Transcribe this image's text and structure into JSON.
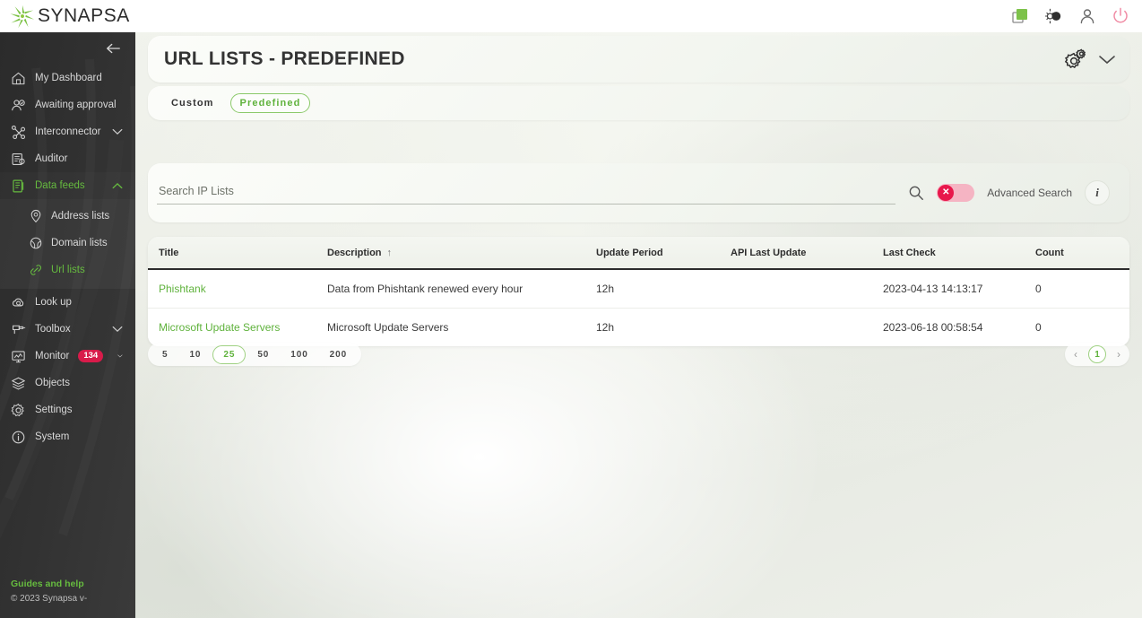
{
  "brand": {
    "name": "SYNAPSA",
    "logo_icon": "synapsa-starburst-logo",
    "accent": "#66bb3f",
    "danger": "#e8174b"
  },
  "topbar": {
    "icons": [
      {
        "name": "copy-icon",
        "color": "#7dc24a"
      },
      {
        "name": "theme-toggle-icon",
        "color": "#3a3a3a"
      },
      {
        "name": "user-icon",
        "color": "#6b6b6b"
      },
      {
        "name": "power-icon",
        "color": "#f08ca5"
      }
    ]
  },
  "sidebar": {
    "collapse_icon": "arrow-left-icon",
    "items": [
      {
        "label": "My Dashboard",
        "icon": "home-icon",
        "chevron": false,
        "active": false
      },
      {
        "label": "Awaiting approval",
        "icon": "user-check-icon",
        "chevron": false,
        "active": false
      },
      {
        "label": "Interconnector",
        "icon": "network-icon",
        "chevron": true,
        "active": false
      },
      {
        "label": "Auditor",
        "icon": "server-audit-icon",
        "chevron": false,
        "active": false
      },
      {
        "label": "Data feeds",
        "icon": "data-feeds-icon",
        "chevron": true,
        "active": true,
        "expanded": true
      }
    ],
    "sub_items": [
      {
        "label": "Address lists",
        "icon": "map-pin-icon",
        "active": false
      },
      {
        "label": "Domain lists",
        "icon": "globe-icon",
        "active": false
      },
      {
        "label": "Url lists",
        "icon": "link-icon",
        "active": true
      }
    ],
    "items_after": [
      {
        "label": "Look up",
        "icon": "cloud-search-icon",
        "chevron": false,
        "badge": null
      },
      {
        "label": "Toolbox",
        "icon": "drill-icon",
        "chevron": true,
        "badge": null
      },
      {
        "label": "Monitor",
        "icon": "monitor-icon",
        "chevron": true,
        "badge": "134"
      },
      {
        "label": "Objects",
        "icon": "layers-icon",
        "chevron": false,
        "badge": null
      },
      {
        "label": "Settings",
        "icon": "gear-icon",
        "chevron": false,
        "badge": null
      },
      {
        "label": "System",
        "icon": "info-circle-icon",
        "chevron": false,
        "badge": null
      }
    ],
    "footer": {
      "guides": "Guides and help",
      "copyright": "© 2023 Synapsa v-"
    }
  },
  "header": {
    "title": "URL LISTS - PREDEFINED",
    "gears_icon": "gears-settings-icon",
    "chevron_icon": "chevron-down-icon"
  },
  "tabs": [
    {
      "label": "Custom",
      "active": false
    },
    {
      "label": "Predefined",
      "active": true
    }
  ],
  "search": {
    "placeholder": "Search IP Lists",
    "value": "",
    "search_icon": "search-icon",
    "advanced_label": "Advanced Search",
    "advanced_enabled": false,
    "toggle_glyph": "✕",
    "info_glyph": "i"
  },
  "table": {
    "columns": [
      {
        "key": "title",
        "label": "Title",
        "sorted": false
      },
      {
        "key": "desc",
        "label": "Description",
        "sorted": true,
        "sort_glyph": "↑"
      },
      {
        "key": "period",
        "label": "Update Period",
        "sorted": false
      },
      {
        "key": "api",
        "label": "API Last Update",
        "sorted": false
      },
      {
        "key": "check",
        "label": "Last Check",
        "sorted": false
      },
      {
        "key": "count",
        "label": "Count",
        "sorted": false
      }
    ],
    "rows": [
      {
        "title": "Phishtank",
        "desc": "Data from Phishtank renewed every hour",
        "period": "12h",
        "api": "",
        "check": "2023-04-13 14:13:17",
        "count": "0"
      },
      {
        "title": "Microsoft Update Servers",
        "desc": "Microsoft Update Servers",
        "period": "12h",
        "api": "",
        "check": "2023-06-18 00:58:54",
        "count": "0"
      }
    ]
  },
  "pagination": {
    "page_sizes": [
      "5",
      "10",
      "25",
      "50",
      "100",
      "200"
    ],
    "selected_size": "25",
    "prev_glyph": "‹",
    "next_glyph": "›",
    "current_page": "1"
  }
}
